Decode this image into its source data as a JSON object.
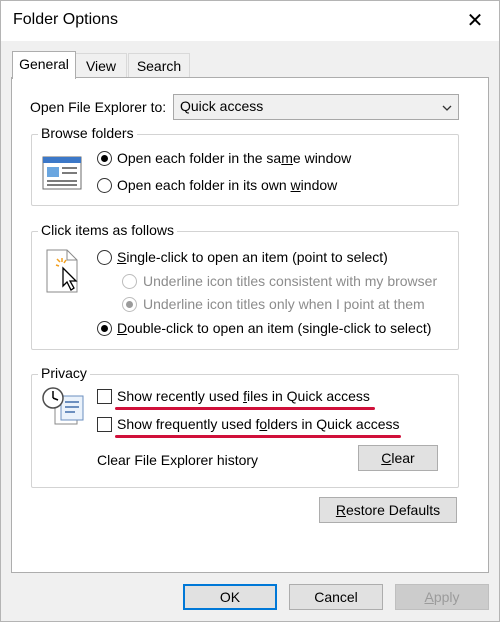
{
  "window": {
    "title": "Folder Options",
    "close_glyph": "✕"
  },
  "tabs": [
    {
      "label": "General",
      "active": true
    },
    {
      "label": "View",
      "active": false
    },
    {
      "label": "Search",
      "active": false
    }
  ],
  "open_to": {
    "label": "Open File Explorer to:",
    "value": "Quick access"
  },
  "browse": {
    "title": "Browse folders",
    "options": [
      {
        "before": "Open each folder in the sa",
        "u": "m",
        "after": "e window",
        "checked": true
      },
      {
        "before": "Open each folder in its own ",
        "u": "w",
        "after": "indow",
        "checked": false
      }
    ]
  },
  "click": {
    "title": "Click items as follows",
    "single": {
      "before": "",
      "u": "S",
      "after": "ingle-click to open an item (point to select)",
      "checked": false
    },
    "sub1": {
      "text": "Underline icon titles consistent with my browser",
      "checked": false,
      "disabled": true
    },
    "sub2": {
      "text": "Underline icon titles only when I point at them",
      "checked": true,
      "disabled": true
    },
    "double": {
      "before": "",
      "u": "D",
      "after": "ouble-click to open an item (single-click to select)",
      "checked": true
    }
  },
  "privacy": {
    "title": "Privacy",
    "recent_files": {
      "before": "Show recently used ",
      "u": "f",
      "after": "iles in Quick access",
      "checked": false
    },
    "frequent_folders": {
      "before": "Show frequently used f",
      "u": "o",
      "after": "lders in Quick access",
      "checked": false
    },
    "history_label": "Clear File Explorer history",
    "clear_button": {
      "before": "",
      "u": "C",
      "after": "lear"
    }
  },
  "restore_button": {
    "before": "",
    "u": "R",
    "after": "estore Defaults"
  },
  "footer": {
    "ok": "OK",
    "cancel": "Cancel",
    "apply": {
      "before": "",
      "u": "A",
      "after": "pply",
      "disabled": true
    }
  },
  "colors": {
    "annotation_red": "#d0103a",
    "focus_blue": "#0078d7",
    "dialog_gray": "#f0f0f0"
  }
}
